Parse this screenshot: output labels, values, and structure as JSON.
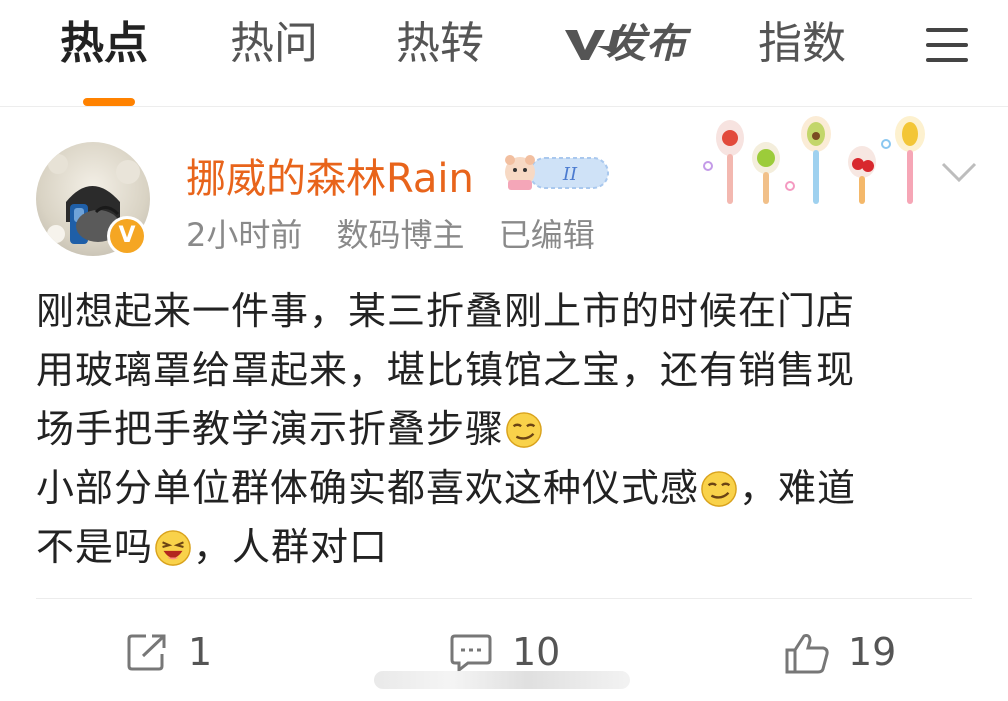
{
  "tabs": [
    {
      "label": "热点",
      "active": true
    },
    {
      "label": "热问",
      "active": false
    },
    {
      "label": "热转",
      "active": false
    },
    {
      "label": "发布",
      "icon": "v-logo-icon",
      "active": false
    },
    {
      "label": "指数",
      "active": false
    }
  ],
  "accent_color": "#ff8200",
  "post": {
    "username": "挪威的森林Rain",
    "meta": {
      "time": "2小时前",
      "role": "数码博主",
      "edited": "已编辑"
    },
    "lines": [
      {
        "text": "刚想起来一件事，某三折叠刚上市的时候在门店"
      },
      {
        "text": "用玻璃罩给罩起来，堪比镇馆之宝，还有销售现"
      },
      {
        "text": "场手把手教学演示折叠步骤",
        "emoji_after": "smirk-emoji"
      },
      {
        "segments": [
          "小部分单位群体确实都喜欢这种仪式感",
          "，难道"
        ],
        "emoji_mid": "smirk-emoji"
      },
      {
        "segments": [
          "不是吗",
          "，人群对口"
        ],
        "emoji_mid": "laughing-emoji"
      }
    ],
    "actions": {
      "repost_count": "1",
      "comment_count": "10",
      "like_count": "19"
    }
  }
}
